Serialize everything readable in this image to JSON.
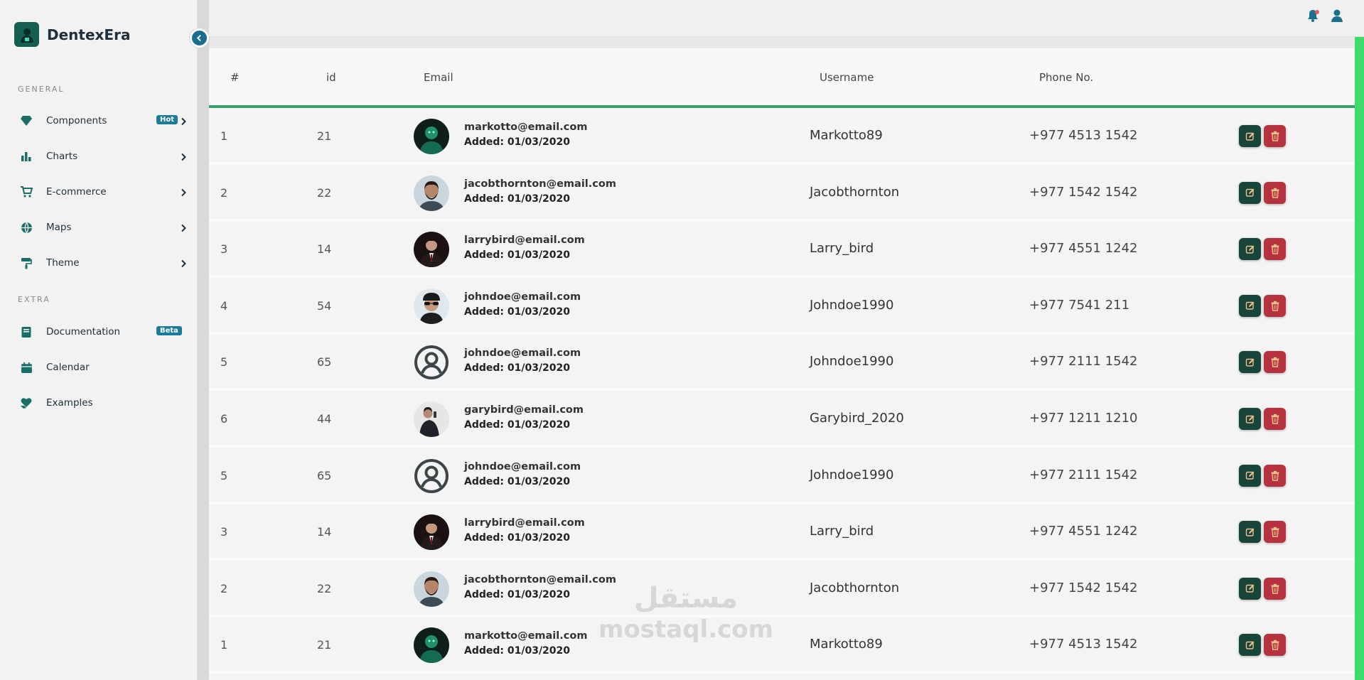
{
  "brand": {
    "name": "DentexEra"
  },
  "sidebar": {
    "general_label": "GENERAL",
    "extra_label": "EXTRA",
    "general_items": [
      {
        "label": "Components",
        "icon": "diamond-icon",
        "badge": "Hot",
        "chevron": true
      },
      {
        "label": "Charts",
        "icon": "bar-chart-icon",
        "chevron": true
      },
      {
        "label": "E-commerce",
        "icon": "cart-icon",
        "chevron": true
      },
      {
        "label": "Maps",
        "icon": "globe-icon",
        "chevron": true
      },
      {
        "label": "Theme",
        "icon": "paint-roller-icon",
        "chevron": true
      }
    ],
    "extra_items": [
      {
        "label": "Documentation",
        "icon": "book-icon",
        "badge": "Beta"
      },
      {
        "label": "Calendar",
        "icon": "calendar-icon"
      },
      {
        "label": "Examples",
        "icon": "heart-hand-icon"
      }
    ]
  },
  "table": {
    "headers": [
      "#",
      "id",
      "Email",
      "Username",
      "Phone No."
    ],
    "rows": [
      {
        "num": "1",
        "id": "21",
        "email": "markotto@email.com",
        "added": "Added: 01/03/2020",
        "username": "Markotto89",
        "phone": "+977 4513 1542",
        "avatar": "green-portrait"
      },
      {
        "num": "2",
        "id": "22",
        "email": "jacobthornton@email.com",
        "added": "Added: 01/03/2020",
        "username": "Jacobthornton",
        "phone": "+977 1542 1542",
        "avatar": "bearded-portrait"
      },
      {
        "num": "3",
        "id": "14",
        "email": "larrybird@email.com",
        "added": "Added: 01/03/2020",
        "username": "Larry_bird",
        "phone": "+977 4551 1242",
        "avatar": "suit-portrait"
      },
      {
        "num": "4",
        "id": "54",
        "email": "johndoe@email.com",
        "added": "Added: 01/03/2020",
        "username": "Johndoe1990",
        "phone": "+977 7541 211",
        "avatar": "sunglasses-portrait"
      },
      {
        "num": "5",
        "id": "65",
        "email": "johndoe@email.com",
        "added": "Added: 01/03/2020",
        "username": "Johndoe1990",
        "phone": "+977 2111 1542",
        "avatar": "default-user"
      },
      {
        "num": "6",
        "id": "44",
        "email": "garybird@email.com",
        "added": "Added: 01/03/2020",
        "username": "Garybird_2020",
        "phone": "+977 1211 1210",
        "avatar": "phone-portrait"
      },
      {
        "num": "5",
        "id": "65",
        "email": "johndoe@email.com",
        "added": "Added: 01/03/2020",
        "username": "Johndoe1990",
        "phone": "+977 2111 1542",
        "avatar": "default-user"
      },
      {
        "num": "3",
        "id": "14",
        "email": "larrybird@email.com",
        "added": "Added: 01/03/2020",
        "username": "Larry_bird",
        "phone": "+977 4551 1242",
        "avatar": "suit-portrait"
      },
      {
        "num": "2",
        "id": "22",
        "email": "jacobthornton@email.com",
        "added": "Added: 01/03/2020",
        "username": "Jacobthornton",
        "phone": "+977 1542 1542",
        "avatar": "bearded-portrait"
      },
      {
        "num": "1",
        "id": "21",
        "email": "markotto@email.com",
        "added": "Added: 01/03/2020",
        "username": "Markotto89",
        "phone": "+977 4513 1542",
        "avatar": "green-portrait"
      }
    ]
  },
  "watermark": {
    "arabic": "مستقل",
    "latin": "mostaql.com"
  },
  "colors": {
    "accent": "#37a36a",
    "edit": "#17453a",
    "delete": "#b5323e",
    "brand": "#155e52",
    "badge": "#1a7c9a"
  }
}
